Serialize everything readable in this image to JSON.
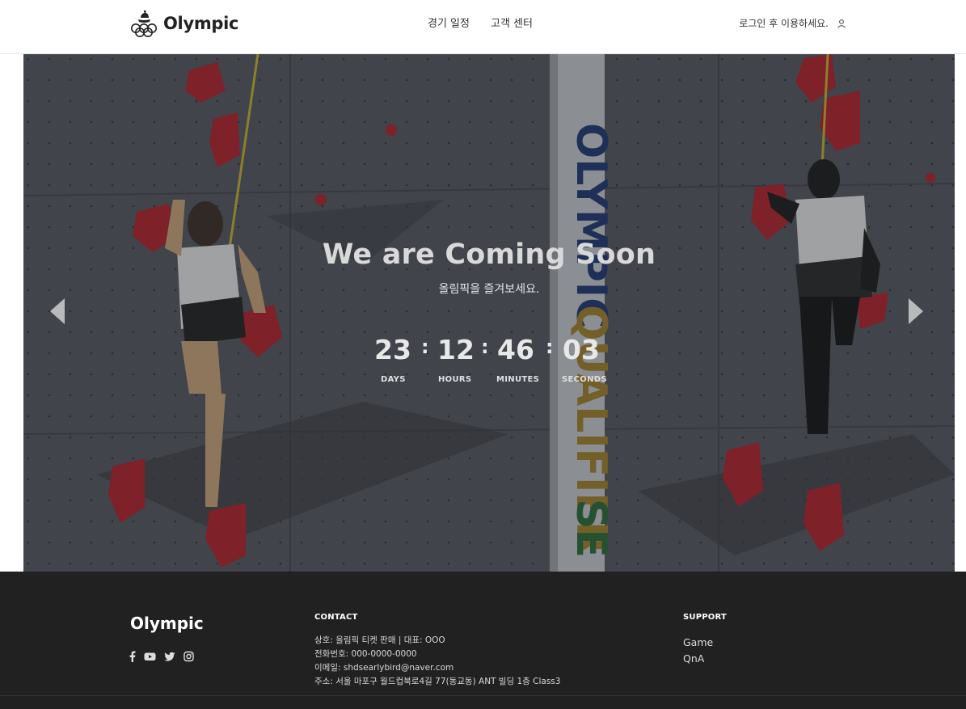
{
  "header": {
    "logo_text": "Olympic",
    "nav": [
      {
        "label": "경기 일정"
      },
      {
        "label": "고객 센터"
      }
    ],
    "login_text": "로그인 후 이용하세요."
  },
  "hero": {
    "title": "We are Coming Soon",
    "subtitle": "올림픽을 즐겨보세요.",
    "banner_text": "OLYMPIC QUALIFIER SE",
    "countdown": {
      "days": "23",
      "hours": "12",
      "minutes": "46",
      "seconds": "03",
      "separator": ":",
      "labels": {
        "days": "DAYS",
        "hours": "HOURS",
        "minutes": "MINUTES",
        "seconds": "SECONDS"
      }
    }
  },
  "footer": {
    "logo_text": "Olympic",
    "social_icons": [
      "facebook-icon",
      "youtube-icon",
      "twitter-icon",
      "instagram-icon"
    ],
    "contact": {
      "heading": "CONTACT",
      "lines": [
        "상호: 올림픽 티켓 판매 | 대표: OOO",
        "전화번호: 000-0000-0000",
        "이메일: shdsearlybird@naver.com",
        "주소: 서울 마포구 월드컵북로4길 77(동교동) ANT 빌딩 1층 Class3"
      ]
    },
    "support": {
      "heading": "SUPPORT",
      "links": [
        "Game",
        "QnA"
      ]
    }
  },
  "colors": {
    "footer_bg": "#212121",
    "hold_red": "#c8202b",
    "wall_gray": "#4b4e55"
  }
}
